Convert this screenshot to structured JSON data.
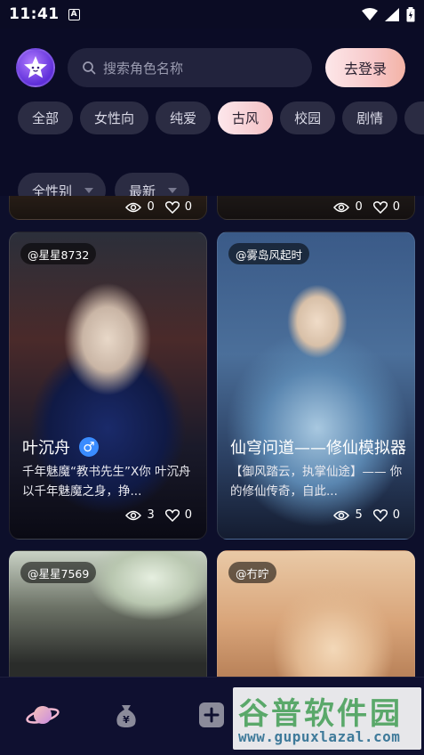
{
  "status": {
    "time": "11:41"
  },
  "search": {
    "placeholder": "搜索角色名称"
  },
  "login_label": "去登录",
  "tags": [
    "全部",
    "女性向",
    "纯爱",
    "古风",
    "校园",
    "剧情"
  ],
  "filters": {
    "gender": "全性别",
    "sort": "最新"
  },
  "cards": [
    {
      "author": "@星星8732",
      "name": "叶沉舟",
      "gender": "♂",
      "desc": "千年魅魔“教书先生”X你 叶沉舟以千年魅魔之身，挣...",
      "views": "3",
      "likes": "0"
    },
    {
      "author": "@雾岛风起时",
      "name": "仙穹问道——修仙模拟器",
      "desc": "【御风踏云，执掌仙途】—— 你的修仙传奇，自此...",
      "views": "5",
      "likes": "0"
    },
    {
      "author": "@星星7569"
    },
    {
      "author": "@冇咛"
    }
  ],
  "top_cards": [
    {
      "views": "0",
      "likes": "0"
    },
    {
      "views": "0",
      "likes": "0"
    }
  ],
  "watermark": {
    "brand": "谷普软件园",
    "url": "www.gupuxlazal.com"
  },
  "colors": {
    "background": "#0d0f2b",
    "accent": "#f3c0c3",
    "card_border": "#2a2b45"
  }
}
